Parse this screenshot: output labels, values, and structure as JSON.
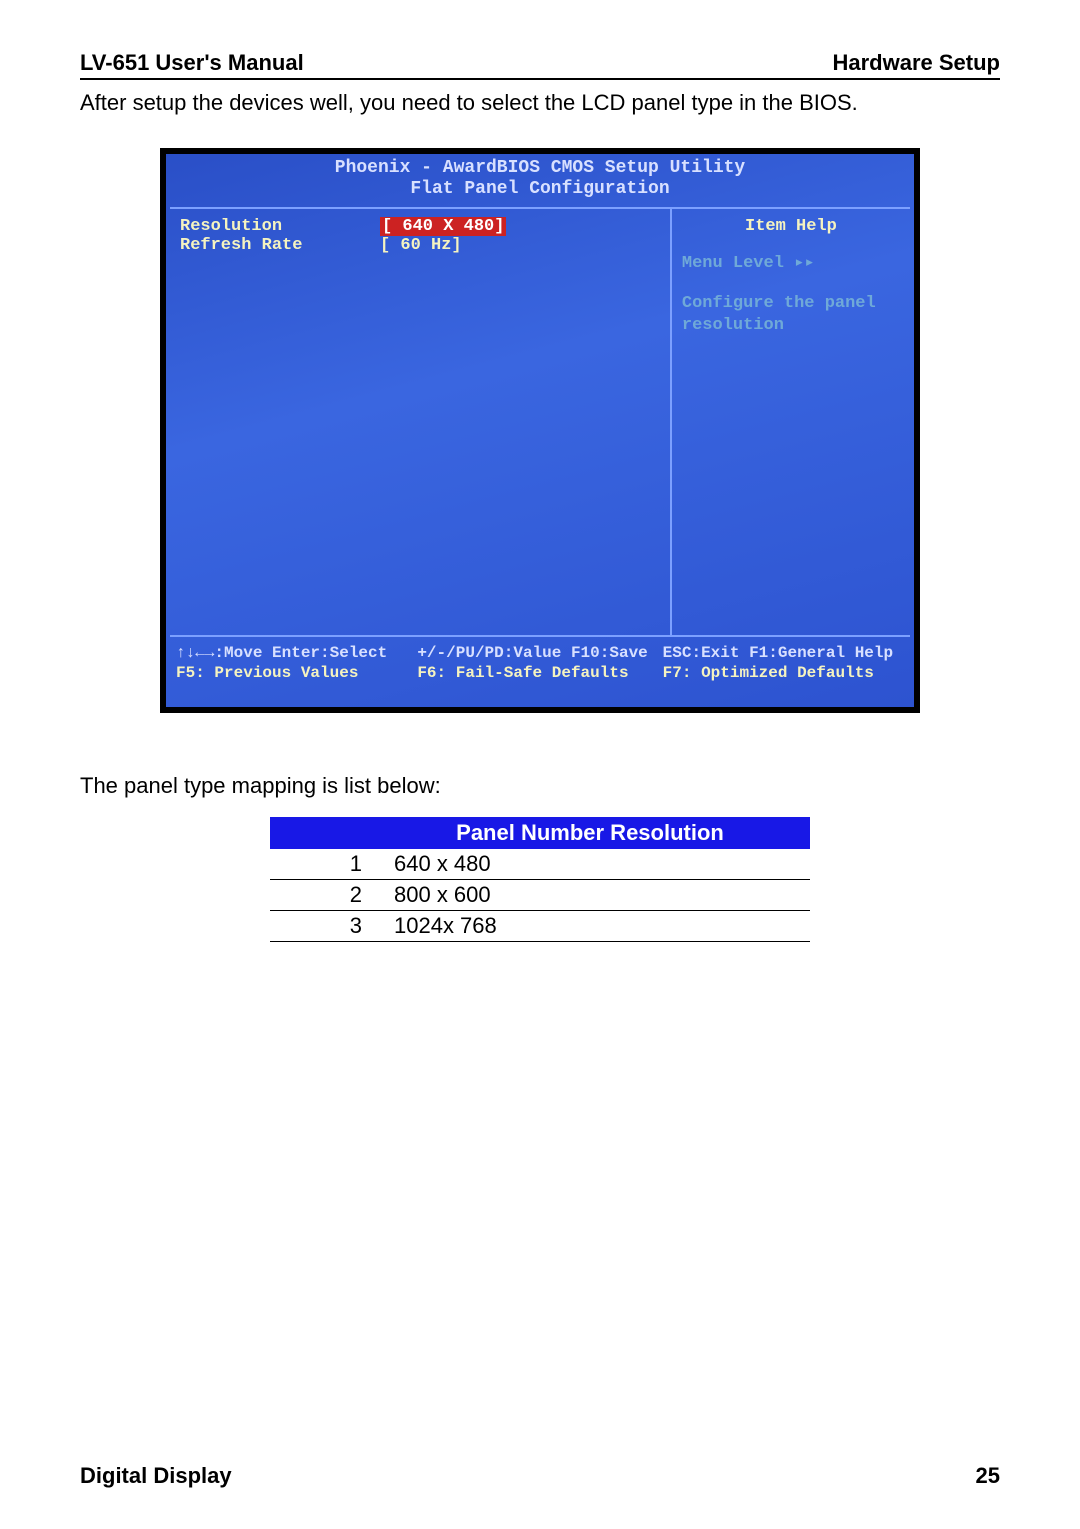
{
  "header": {
    "left": "LV-651 User's Manual",
    "right": "Hardware Setup"
  },
  "intro": "After setup the devices well, you need to select the LCD panel type in the BIOS.",
  "bios": {
    "title_line1": "Phoenix - AwardBIOS CMOS Setup Utility",
    "title_line2": "Flat Panel Configuration",
    "rows": [
      {
        "label": "Resolution",
        "value": "[ 640 X  480]",
        "selected": true
      },
      {
        "label": "Refresh Rate",
        "value": "[ 60 Hz]",
        "selected": false
      }
    ],
    "help_title": "Item Help",
    "menu_level": "Menu Level   ▸▸",
    "help_text": "Configure the panel resolution",
    "footer_left_line1": "↑↓←→:Move  Enter:Select",
    "footer_left_line2": "F5: Previous Values",
    "footer_mid_line1": "+/-/PU/PD:Value  F10:Save",
    "footer_mid_line2": "F6: Fail-Safe Defaults",
    "footer_right_line1": "ESC:Exit  F1:General Help",
    "footer_right_line2": "F7: Optimized Defaults"
  },
  "caption": "The panel type mapping is list below:",
  "table": {
    "header_blank": "",
    "header_main": "Panel Number Resolution",
    "rows": [
      {
        "num": "1",
        "res": "640 x 480"
      },
      {
        "num": "2",
        "res": "800 x 600"
      },
      {
        "num": "3",
        "res": "1024x 768"
      }
    ]
  },
  "footer": {
    "left": "Digital Display",
    "right": "25"
  }
}
